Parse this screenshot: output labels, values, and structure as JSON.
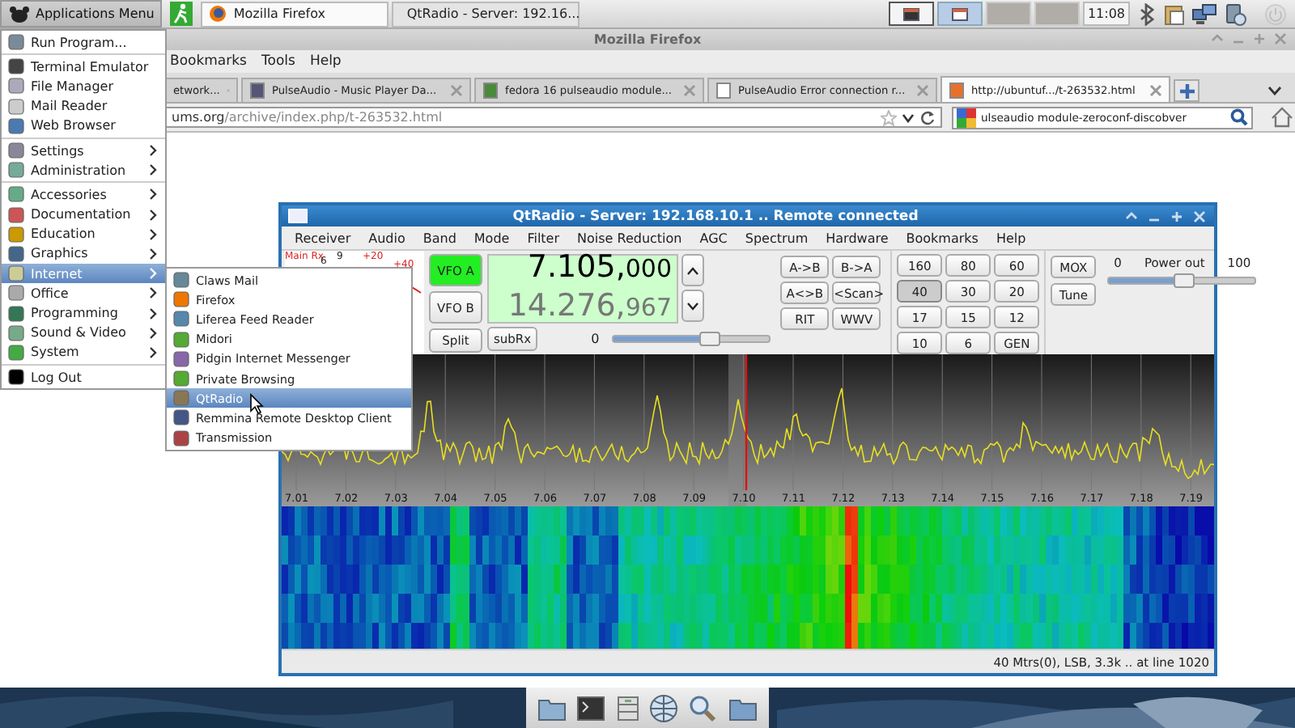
{
  "top_panel": {
    "apps_button": "Applications Menu",
    "tasks": [
      {
        "label": "Mozilla Firefox",
        "selected": true
      },
      {
        "label": "QtRadio - Server: 192.16...",
        "selected": false
      }
    ],
    "workspaces": [
      {
        "selected": false
      },
      {
        "selected": true
      },
      {
        "selected": false
      },
      {
        "selected": false
      }
    ],
    "clock": "11:08"
  },
  "browser": {
    "title": "Mozilla Firefox",
    "menus": [
      "Bookmarks",
      "Tools",
      "Help"
    ],
    "tabs": [
      {
        "label": "etwork...",
        "selected": false
      },
      {
        "label": "PulseAudio - Music Player Da...",
        "selected": false
      },
      {
        "label": "fedora 16 pulseaudio module...",
        "selected": false
      },
      {
        "label": "PulseAudio Error connection r...",
        "selected": false
      },
      {
        "label": "http://ubuntuf.../t-263532.html",
        "selected": true
      }
    ],
    "url_host": "ums.org",
    "url_path": "/archive/index.php/t-263532.html",
    "search": "ulseaudio module-zeroconf-discobver"
  },
  "apps_menu": {
    "sections": [
      [
        {
          "label": "Run Program...",
          "submenu": false,
          "selected": false
        }
      ],
      [
        {
          "label": "Terminal Emulator",
          "submenu": false,
          "selected": false
        },
        {
          "label": "File Manager",
          "submenu": false,
          "selected": false
        },
        {
          "label": "Mail Reader",
          "submenu": false,
          "selected": false
        },
        {
          "label": "Web Browser",
          "submenu": false,
          "selected": false
        }
      ],
      [
        {
          "label": "Settings",
          "submenu": true,
          "selected": false
        },
        {
          "label": "Administration",
          "submenu": true,
          "selected": false
        }
      ],
      [
        {
          "label": "Accessories",
          "submenu": true,
          "selected": false
        },
        {
          "label": "Documentation",
          "submenu": true,
          "selected": false
        },
        {
          "label": "Education",
          "submenu": true,
          "selected": false
        },
        {
          "label": "Graphics",
          "submenu": true,
          "selected": false
        },
        {
          "label": "Internet",
          "submenu": true,
          "selected": true
        },
        {
          "label": "Office",
          "submenu": true,
          "selected": false
        },
        {
          "label": "Programming",
          "submenu": true,
          "selected": false
        },
        {
          "label": "Sound & Video",
          "submenu": true,
          "selected": false
        },
        {
          "label": "System",
          "submenu": true,
          "selected": false
        }
      ],
      [
        {
          "label": "Log Out",
          "submenu": false,
          "selected": false
        }
      ]
    ]
  },
  "internet_menu": {
    "items": [
      {
        "label": "Claws Mail",
        "selected": false
      },
      {
        "label": "Firefox",
        "selected": false
      },
      {
        "label": "Liferea Feed Reader",
        "selected": false
      },
      {
        "label": "Midori",
        "selected": false
      },
      {
        "label": "Pidgin Internet Messenger",
        "selected": false
      },
      {
        "label": "Private Browsing",
        "selected": false
      },
      {
        "label": "QtRadio",
        "selected": true
      },
      {
        "label": "Remmina Remote Desktop Client",
        "selected": false
      },
      {
        "label": "Transmission",
        "selected": false
      }
    ]
  },
  "qtradio": {
    "title": "QtRadio - Server: 192.168.10.1 .. Remote connected",
    "menus": [
      "Receiver",
      "Audio",
      "Band",
      "Mode",
      "Filter",
      "Noise Reduction",
      "AGC",
      "Spectrum",
      "Hardware",
      "Bookmarks",
      "Help"
    ],
    "meter": {
      "label": "Main Rx",
      "scale": [
        "6",
        "9",
        "+20",
        "+40"
      ]
    },
    "vfos": [
      {
        "label": "VFO A",
        "selected": true,
        "main": "7.105,",
        "fine": "000"
      },
      {
        "label": "VFO B",
        "selected": false,
        "main": "14.276,",
        "fine": "967"
      }
    ],
    "split": "Split",
    "subrx": "subRx",
    "gain": {
      "label": "0",
      "level": 0.6
    },
    "vfo_buttons": [
      "A->B",
      "B->A",
      "A<>B",
      "<Scan>",
      "RIT",
      "WWV"
    ],
    "bands": [
      {
        "label": "160",
        "selected": false
      },
      {
        "label": "80",
        "selected": false
      },
      {
        "label": "60",
        "selected": false
      },
      {
        "label": "40",
        "selected": true
      },
      {
        "label": "30",
        "selected": false
      },
      {
        "label": "20",
        "selected": false
      },
      {
        "label": "17",
        "selected": false
      },
      {
        "label": "15",
        "selected": false
      },
      {
        "label": "12",
        "selected": false
      },
      {
        "label": "10",
        "selected": false
      },
      {
        "label": "6",
        "selected": false
      },
      {
        "label": "GEN",
        "selected": false
      }
    ],
    "mox": "MOX",
    "tune": "Tune",
    "power": {
      "min": "0",
      "label": "Power out",
      "max": "100",
      "level": 0.5
    },
    "ticks": [
      "7.01",
      "7.02",
      "7.03",
      "7.04",
      "7.05",
      "7.06",
      "7.07",
      "7.08",
      "7.09",
      "7.10",
      "7.11",
      "7.12",
      "7.13",
      "7.14",
      "7.15",
      "7.16",
      "7.17",
      "7.18",
      "7.19"
    ],
    "status": "40 Mtrs(0), LSB, 3.3k .. at line 1020"
  }
}
